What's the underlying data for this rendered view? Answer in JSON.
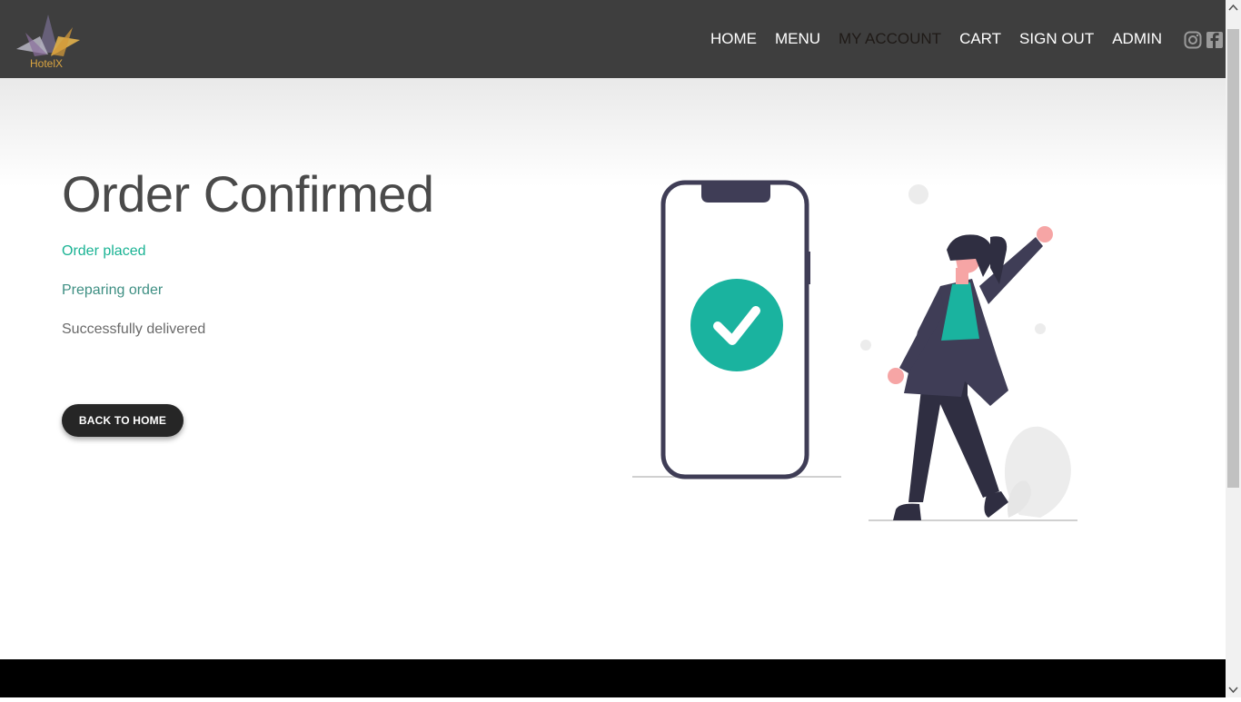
{
  "brand": {
    "name": "HotelX"
  },
  "nav": {
    "items": [
      {
        "label": "HOME",
        "active": false
      },
      {
        "label": "MENU",
        "active": false
      },
      {
        "label": "MY ACCOUNT",
        "active": true
      },
      {
        "label": "CART",
        "active": false
      },
      {
        "label": "SIGN OUT",
        "active": false
      },
      {
        "label": "ADMIN",
        "active": false
      }
    ],
    "social": [
      "instagram-icon",
      "facebook-icon"
    ]
  },
  "main": {
    "title": "Order Confirmed",
    "steps": [
      {
        "label": "Order placed",
        "color": "#1ab394"
      },
      {
        "label": "Preparing order",
        "color": "#3e8f83"
      },
      {
        "label": "Successfully delivered",
        "color": "#6a6a6a"
      }
    ],
    "back_button": "BACK TO HOME"
  },
  "colors": {
    "navbar_bg": "#3e3e3e",
    "accent_green": "#1ab394",
    "button_bg": "#262626",
    "footer_bg": "#000000"
  }
}
